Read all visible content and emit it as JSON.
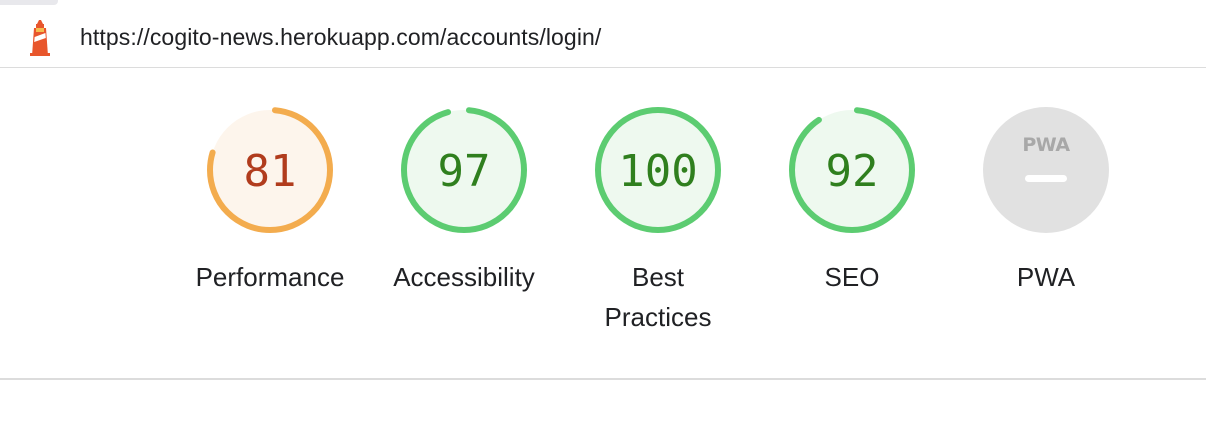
{
  "browser": {
    "url": "https://cogito-news.herokuapp.com/accounts/login/",
    "favicon": "lighthouse-icon"
  },
  "categories": [
    {
      "label": "Performance",
      "score": "81",
      "value": 0.81,
      "status": "average"
    },
    {
      "label": "Accessibility",
      "score": "97",
      "value": 0.97,
      "status": "pass"
    },
    {
      "label": "Best Practices",
      "score": "100",
      "value": 1.0,
      "status": "pass"
    },
    {
      "label": "SEO",
      "score": "92",
      "value": 0.92,
      "status": "pass"
    },
    {
      "label": "PWA",
      "badge": "PWA",
      "status": "not-applicable"
    }
  ],
  "colors": {
    "average_stroke": "#f3ac4e",
    "average_fill": "#fdf5ec",
    "average_text": "#b13c1d",
    "pass_stroke": "#5ccc71",
    "pass_fill": "#eef9ef",
    "pass_text": "#2f7f1e",
    "pwa_fill": "#e1e1e1",
    "pwa_mark": "#ffffff",
    "pwa_text": "#a8a8a8"
  }
}
